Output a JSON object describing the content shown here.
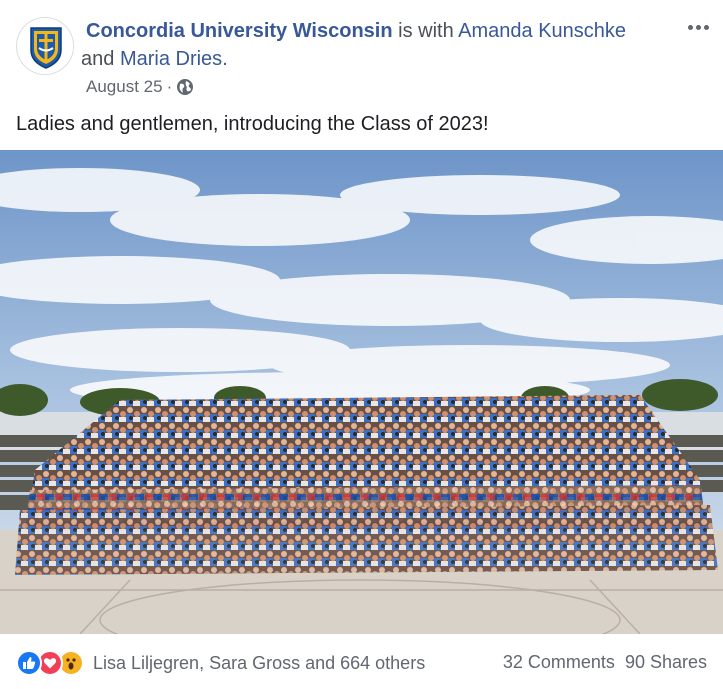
{
  "post": {
    "author": "Concordia University Wisconsin",
    "with_text": " is with ",
    "tagged_1": "Amanda Kunschke",
    "and_text": " and ",
    "tagged_2": "Maria Dries",
    "period": ".",
    "date": "August 25",
    "separator": "·",
    "privacy_icon": "globe-icon",
    "caption": "Ladies and gentlemen, introducing the Class of 2023!",
    "menu_icon": "more-options-icon"
  },
  "photo": {
    "subject": "class-group-photo"
  },
  "footer": {
    "reactions": [
      "like-reaction-icon",
      "love-reaction-icon",
      "wow-reaction-icon"
    ],
    "reactions_text": "Lisa Liljegren, Sara Gross and 664 others",
    "comments": "32 Comments",
    "shares": "90 Shares"
  },
  "colors": {
    "link": "#385898",
    "secondary_text": "#616770",
    "like": "#1877f2",
    "love": "#f33e58",
    "wow": "#f7b125"
  }
}
